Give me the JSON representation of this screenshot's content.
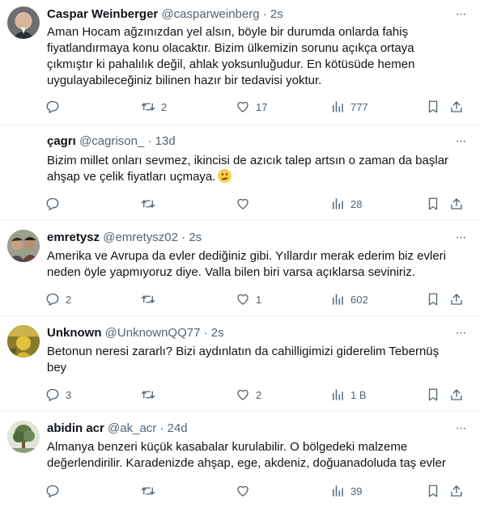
{
  "tweets": [
    {
      "name": "Caspar Weinberger",
      "handle": "@casparweinberg",
      "time": "2s",
      "text": "Aman Hocam ağzınızdan yel alsın, böyle bir durumda onlarda fahiş\nfiyatlandırmaya konu olacaktır. Bizim ülkemizin sorunu açıkça ortaya\nçıkmıştır ki pahalılık değil, ahlak yoksunluğudur. En kötüsüde hemen\nuygulayabileceğiniz bilinen hazır bir tedavisi yoktur.",
      "replies": "",
      "retweets": "2",
      "likes": "17",
      "views": "777"
    },
    {
      "name": "çagrı",
      "handle": "@cagrison_",
      "time": "13d",
      "text": "Bizim millet onları sevmez, ikincisi de azıcık talep artsın o zaman da başlar\nahşap ve çelik fiyatları uçmaya.",
      "emoji": "confused-face",
      "replies": "",
      "retweets": "",
      "likes": "",
      "views": "28"
    },
    {
      "name": "emretysz",
      "handle": "@emretysz02",
      "time": "2s",
      "text": "Amerika ve Avrupa da evler dediğiniz gibi. Yıllardır merak ederim biz evleri\nneden öyle yapmıyoruz diye. Valla bilen biri varsa açıklarsa seviniriz.",
      "replies": "2",
      "retweets": "",
      "likes": "1",
      "views": "602"
    },
    {
      "name": "Unknown",
      "handle": "@UnknownQQ77",
      "time": "2s",
      "text": "Betonun neresi zararlı? Bizi aydınlatın da cahilligimizi giderelim Tebernüş\nbey",
      "replies": "3",
      "retweets": "",
      "likes": "2",
      "views": "1 B"
    },
    {
      "name": "abidin acr",
      "handle": "@ak_acr",
      "time": "24d",
      "text": "Almanya benzeri küçük kasabalar kurulabilir. O bölgedeki malzeme\ndeğerlendirilir. Karadenizde ahşap, ege, akdeniz, doğuanadoluda taş evler",
      "replies": "",
      "retweets": "",
      "likes": "",
      "views": "39"
    }
  ],
  "separator": "·",
  "more_glyph": "···",
  "colors": {
    "text": "#0f1419",
    "secondary": "#536471",
    "border": "#eff3f4"
  }
}
